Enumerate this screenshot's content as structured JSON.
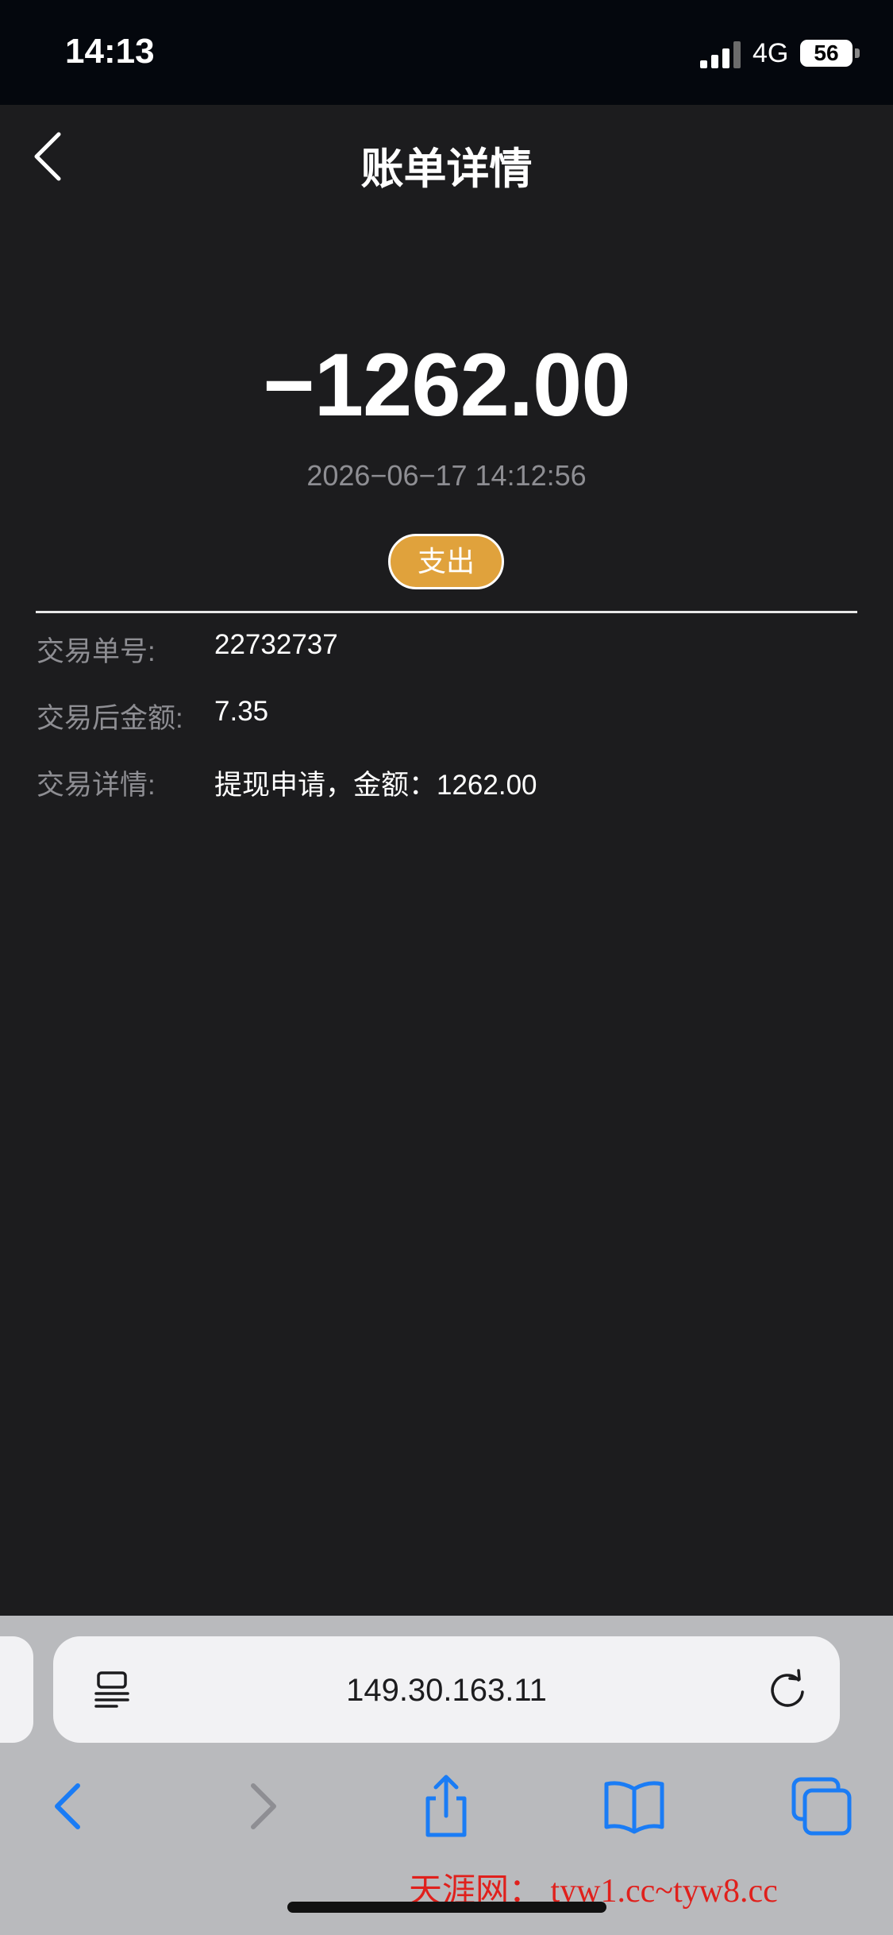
{
  "status_bar": {
    "time": "14:13",
    "network": "4G",
    "battery": "56"
  },
  "header": {
    "title": "账单详情"
  },
  "transaction": {
    "amount": "−1262.00",
    "datetime": "2026−06−17 14:12:56",
    "type": "支出"
  },
  "details": [
    {
      "label": "交易单号:",
      "value": "22732737"
    },
    {
      "label": "交易后金额:",
      "value": "7.35"
    },
    {
      "label": "交易详情:",
      "value": "提现申请，金额：1262.00"
    }
  ],
  "browser": {
    "url": "149.30.163.11",
    "accent_color": "#1a7cf5",
    "toolbar_icons": [
      "back-icon",
      "forward-icon",
      "share-icon",
      "bookmarks-icon",
      "tabs-icon"
    ]
  },
  "watermark": {
    "text": "天涯网： tyw1.cc~tyw8.cc"
  },
  "colors": {
    "background": "#1c1c1e",
    "badge": "#e0a23c",
    "label": "#8e8e93"
  }
}
